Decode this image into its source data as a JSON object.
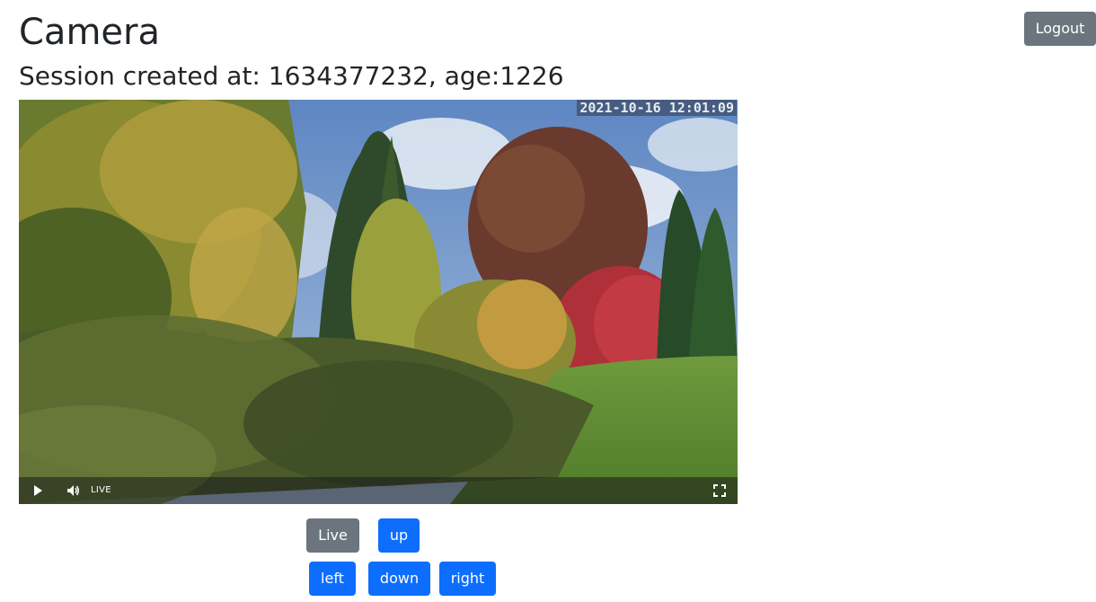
{
  "page": {
    "title": "Camera",
    "session_text": "Session created at: 1634377232, age:1226"
  },
  "header": {
    "logout_label": "Logout"
  },
  "video": {
    "timestamp": "2021-10-16 12:01:09",
    "live_label": "LIVE",
    "icons": [
      "play-icon",
      "volume-icon",
      "fullscreen-icon"
    ]
  },
  "controls": {
    "live_label": "Live",
    "up_label": "up",
    "left_label": "left",
    "down_label": "down",
    "right_label": "right"
  },
  "colors": {
    "primary": "#0d6efd",
    "secondary": "#6c757d"
  }
}
